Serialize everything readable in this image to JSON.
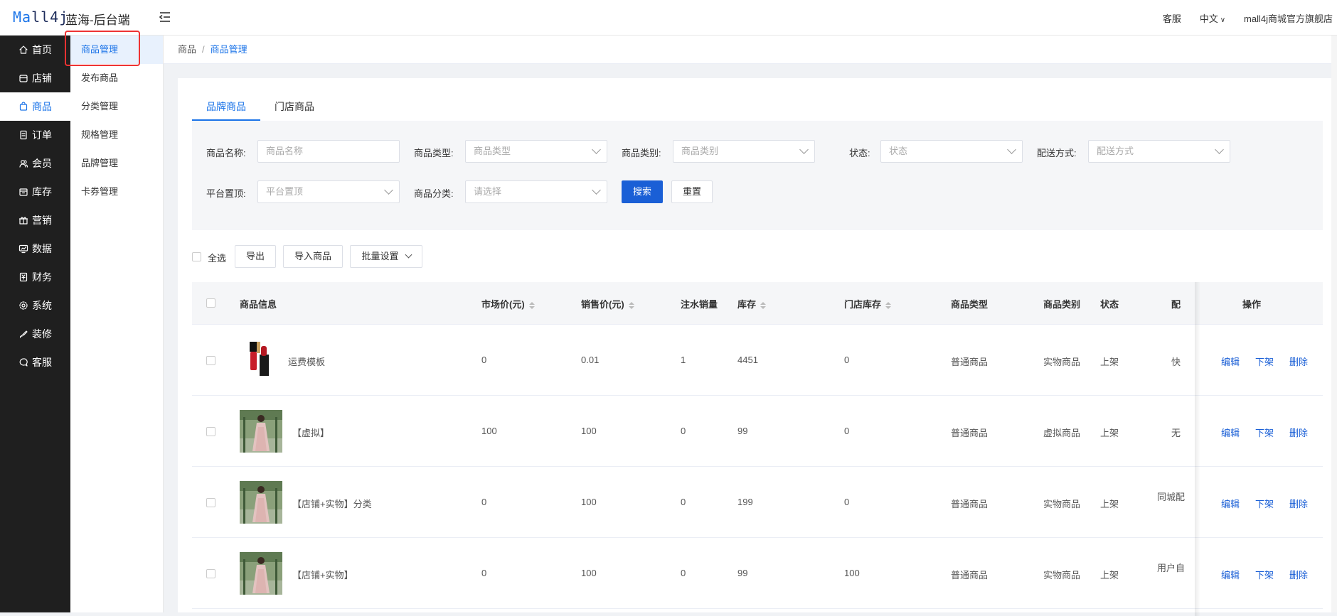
{
  "header": {
    "logo_prefix": "Ma",
    "logo_suffix": "ll4j",
    "title": "蓝海-后台端",
    "right": [
      "客服",
      "中文",
      "mall4j商城官方旗舰店"
    ]
  },
  "nav1": [
    {
      "label": "首页",
      "icon": "home-icon"
    },
    {
      "label": "店铺",
      "icon": "store-icon"
    },
    {
      "label": "商品",
      "icon": "bag-icon",
      "active": true
    },
    {
      "label": "订单",
      "icon": "document-icon"
    },
    {
      "label": "会员",
      "icon": "users-icon"
    },
    {
      "label": "库存",
      "icon": "box-icon"
    },
    {
      "label": "营销",
      "icon": "gift-icon"
    },
    {
      "label": "数据",
      "icon": "monitor-icon"
    },
    {
      "label": "财务",
      "icon": "finance-icon"
    },
    {
      "label": "系统",
      "icon": "gear-icon"
    },
    {
      "label": "装修",
      "icon": "brush-icon"
    },
    {
      "label": "客服",
      "icon": "chat-icon"
    }
  ],
  "nav2": [
    "商品管理",
    "发布商品",
    "分类管理",
    "规格管理",
    "品牌管理",
    "卡券管理"
  ],
  "breadcrumb": {
    "parent": "商品",
    "current": "商品管理"
  },
  "tabs": [
    "品牌商品",
    "门店商品"
  ],
  "filters": {
    "product_name": {
      "label": "商品名称:",
      "placeholder": "商品名称"
    },
    "product_type": {
      "label": "商品类型:",
      "placeholder": "商品类型"
    },
    "product_category": {
      "label": "商品类别:",
      "placeholder": "商品类别"
    },
    "status": {
      "label": "状态:",
      "placeholder": "状态"
    },
    "delivery": {
      "label": "配送方式:",
      "placeholder": "配送方式"
    },
    "platform_top": {
      "label": "平台置顶:",
      "placeholder": "平台置顶"
    },
    "classification": {
      "label": "商品分类:",
      "placeholder": "请选择"
    },
    "search_button": "搜索",
    "reset_button": "重置"
  },
  "toolbar": {
    "select_all": "全选",
    "export": "导出",
    "import": "导入商品",
    "batch": "批量设置"
  },
  "table": {
    "headers": {
      "info": "商品信息",
      "market_price": "市场价(元)",
      "sale_price": "销售价(元)",
      "water_sales": "注水销量",
      "stock": "库存",
      "store_stock": "门店库存",
      "type": "商品类型",
      "category": "商品类别",
      "status": "状态",
      "delivery": "配",
      "ops": "操作"
    },
    "rows": [
      {
        "name": "运费模板",
        "market_price": "0",
        "sale_price": "0.01",
        "water_sales": "1",
        "stock": "4451",
        "store_stock": "0",
        "type": "普通商品",
        "category": "实物商品",
        "status": "上架",
        "delivery": "快",
        "thumb": "lipstick"
      },
      {
        "name": "【虚拟】",
        "market_price": "100",
        "sale_price": "100",
        "water_sales": "0",
        "stock": "99",
        "store_stock": "0",
        "type": "普通商品",
        "category": "虚拟商品",
        "status": "上架",
        "delivery": "无",
        "thumb": "dress"
      },
      {
        "name": "【店铺+实物】分类",
        "market_price": "0",
        "sale_price": "100",
        "water_sales": "0",
        "stock": "199",
        "store_stock": "0",
        "type": "普通商品",
        "category": "实物商品",
        "status": "上架",
        "delivery": "同城配",
        "thumb": "dress"
      },
      {
        "name": "【店铺+实物】",
        "market_price": "0",
        "sale_price": "100",
        "water_sales": "0",
        "stock": "99",
        "store_stock": "100",
        "type": "普通商品",
        "category": "实物商品",
        "status": "上架",
        "delivery": "用户自",
        "thumb": "dress"
      }
    ],
    "ops": {
      "edit": "编辑",
      "offline": "下架",
      "delete": "删除"
    }
  },
  "colors": {
    "accent": "#1a73e8",
    "primary_button": "#1a5fd6",
    "sidebar_bg": "#1f1f1f",
    "highlight_box": "#ee3333"
  }
}
